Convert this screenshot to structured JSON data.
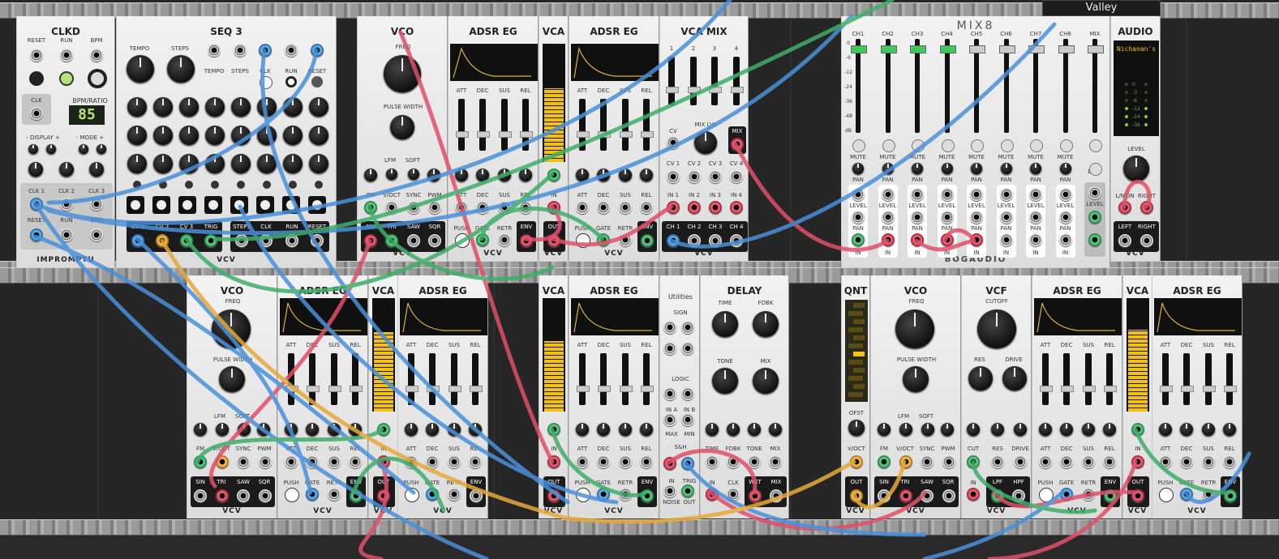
{
  "top_module_labels": {
    "clkd": {
      "title": "CLKD",
      "reset": "RESET",
      "run": "RUN",
      "bpm": "BPM",
      "clk": "CLK",
      "bpm_ratio": "BPM/RATIO",
      "display": "85",
      "display_lbl": "- DISPLAY +",
      "mode_lbl": "- MODE +",
      "clk1": "CLK 1",
      "clk2": "CLK 2",
      "clk3": "CLK 3",
      "reset_out": "RESET",
      "run_out": "RUN",
      "bpm_out": "BPM",
      "brand": "IMPROMPTU"
    },
    "seq3": {
      "title": "SEQ 3",
      "tempo": "TEMPO",
      "steps": "STEPS",
      "clk": "CLK",
      "run": "RUN",
      "reset": "RESET",
      "cv1": "CV 1",
      "cv2": "CV 2",
      "cv3": "CV 3",
      "trig": "TRIG",
      "steps_out": "STEPS",
      "clk_out": "CLK",
      "run_out": "RUN",
      "reset_out": "RESET",
      "brand": "VCV"
    },
    "vco": {
      "title": "VCO",
      "freq": "FREQ",
      "pulse": "PULSE WIDTH",
      "lfm": "LFM",
      "soft": "SOFT",
      "fm": "FM",
      "voct": "V/OCT",
      "sync": "SYNC",
      "pwm": "PWM",
      "sin": "SIN",
      "tri": "TRI",
      "saw": "SAW",
      "sqr": "SQR",
      "brand": "VCV"
    },
    "adsr": {
      "title": "ADSR EG",
      "att": "ATT",
      "dec": "DEC",
      "sus": "SUS",
      "rel": "REL",
      "push": "PUSH",
      "gate": "GATE",
      "retr": "RETR",
      "env": "ENV",
      "brand": "VCV"
    },
    "vca": {
      "title": "VCA",
      "in": "IN",
      "out": "OUT",
      "brand": "VCV"
    },
    "vcamix": {
      "title": "VCA MIX",
      "ch": [
        "1",
        "2",
        "3",
        "4"
      ],
      "cv": "CV",
      "mixlvl": "MIX LVL",
      "mix": "MIX",
      "cvs": [
        "CV 1",
        "CV 2",
        "CV 3",
        "CV 4"
      ],
      "ins": [
        "IN 1",
        "IN 2",
        "IN 3",
        "IN 4"
      ],
      "outs": [
        "CH 1",
        "CH 2",
        "CH 3",
        "CH 4"
      ],
      "brand": "VCV"
    },
    "mix8": {
      "title": "MIX8",
      "channels": [
        "CH1",
        "CH2",
        "CH3",
        "CH4",
        "CH5",
        "CH6",
        "CH7",
        "CH8",
        "MIX"
      ],
      "mute": "MUTE",
      "pan": "PAN",
      "level": "LEVEL",
      "in": "IN",
      "dim": "DIM",
      "brand": "BOGAUDIO",
      "db": [
        "0",
        "-6",
        "-12",
        "-24",
        "-36",
        "-48",
        "dB"
      ]
    },
    "audio": {
      "title": "AUDIO",
      "device": "Nichanan's",
      "level": "LEVEL",
      "lmon": "L/MON",
      "right": "RIGHT",
      "left": "LEFT",
      "brand": "VCV",
      "meter": [
        "0",
        "-3",
        "-6",
        "-12",
        "-24",
        "-36"
      ]
    },
    "valley": {
      "title": "Valley"
    }
  },
  "bottom_module_labels": {
    "utilities": {
      "title": "Utilities",
      "sign": "SIGN",
      "logic": "LOGIC",
      "ina": "IN A",
      "inb": "IN B",
      "max": "MAX",
      "min": "MIN",
      "sh": "S&H",
      "in": "IN",
      "trig": "TRIG",
      "noise": "NOISE",
      "out": "OUT"
    },
    "delay": {
      "title": "DELAY",
      "time": "TIME",
      "fdbk": "FDBK",
      "tone": "TONE",
      "mix": "MIX",
      "in": "IN",
      "clk": "CLK",
      "wet": "WET",
      "mix_out": "MIX"
    },
    "qnt": {
      "title": "QNT",
      "ofst": "OFST",
      "voct": "V/OCT",
      "out": "OUT",
      "brand": "VCV"
    },
    "vcf": {
      "title": "VCF",
      "cutoff": "CUTOFF",
      "res": "RES",
      "drive": "DRIVE",
      "cut": "CUT",
      "res_in": "RES",
      "drive_in": "DRIVE",
      "in": "IN",
      "lpf": "LPF",
      "hpf": "HPF",
      "brand": "VCV"
    }
  },
  "colors": {
    "cable_red": "#e0506a",
    "cable_blue": "#4a90d9",
    "cable_green": "#3fae6a",
    "cable_yellow": "#e6a93a",
    "panel": "#e8e8e8",
    "display_amber": "#f3c018"
  }
}
